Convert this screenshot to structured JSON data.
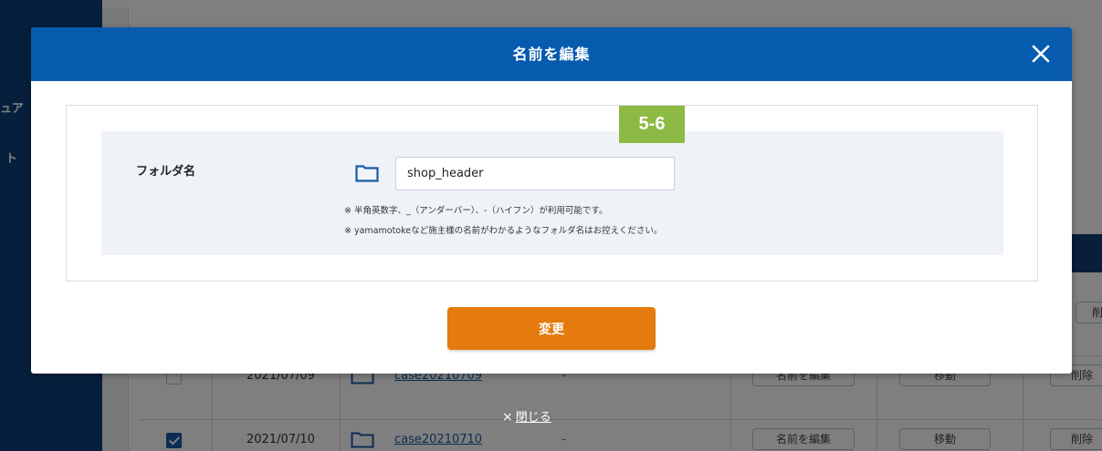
{
  "background": {
    "sidebar": {
      "items": [
        {
          "label": "ュア"
        },
        {
          "label": "ト"
        }
      ]
    },
    "rows": [
      {
        "checked": false,
        "date": "2021/07/09",
        "folder_name": "case20210709",
        "description": "-",
        "rename_label": "名前を編集",
        "move_label": "移動",
        "delete_label": "削除"
      },
      {
        "checked": true,
        "date": "2021/07/10",
        "folder_name": "case20210710",
        "description": "-",
        "rename_label": "名前を編集",
        "move_label": "移動",
        "delete_label": "削除"
      }
    ],
    "side_delete_label": "削除"
  },
  "modal": {
    "title": "名前を編集",
    "close_icon": "close-icon",
    "field_label": "フォルダ名",
    "folder_icon": "folder-icon",
    "input_value": "shop_header",
    "notes": [
      "※ 半角英数字、_（アンダーバー）、-（ハイフン）が利用可能です。",
      "※ yamamotokeなど施主様の名前がわかるようなフォルダ名はお控えください。"
    ],
    "step_badge": "5-6",
    "submit_label": "変更"
  },
  "close_link": {
    "icon": "×",
    "label": "閉じる"
  },
  "colors": {
    "header_blue": "#075bae",
    "submit_orange": "#e57a0e",
    "badge_green": "#8dba44",
    "sidebar_navy": "#0d3e79"
  }
}
